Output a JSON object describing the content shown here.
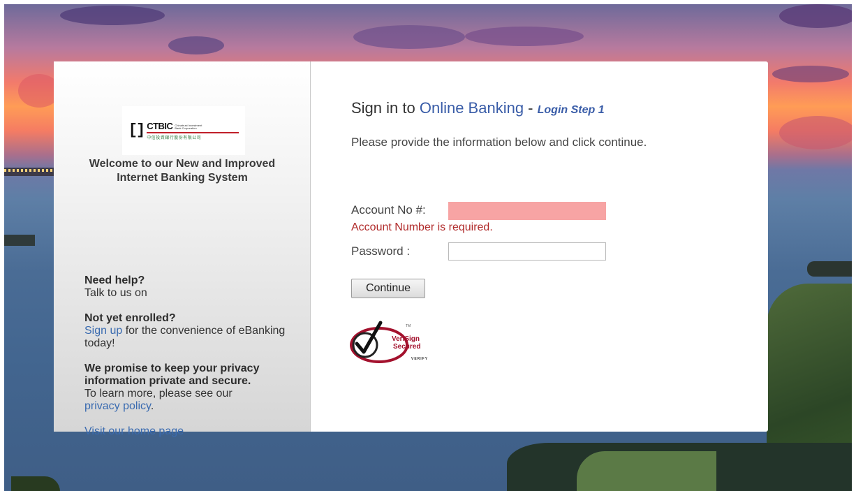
{
  "brand": {
    "logo_name": "CTBIC",
    "logo_english": "Chinatrust Investment Bank Corporation",
    "logo_chinese": "中信投資銀行股份有限公司"
  },
  "left_panel": {
    "welcome": "Welcome to our New and Improved Internet Banking System",
    "help_heading": "Need help?",
    "help_text": "Talk to us on",
    "enroll_heading": "Not yet enrolled?",
    "signup_link": "Sign up",
    "signup_text": " for the convenience of eBanking today!",
    "privacy_heading": "We promise to keep your privacy information private and secure.",
    "privacy_text": "To learn more, please see our",
    "privacy_link": "privacy policy",
    "privacy_tail": ".",
    "home_link": "Visit our home page"
  },
  "login": {
    "title_prefix": "Sign in to ",
    "title_highlight": "Online Banking",
    "title_sep": " - ",
    "step": "Login Step 1",
    "description": "Please provide the information below and click continue.",
    "account_label": "Account No #:",
    "account_value": "",
    "account_error": "Account Number is required.",
    "password_label": "Password :",
    "password_value": "",
    "continue_label": "Continue"
  },
  "seal": {
    "line1": "VeriSign",
    "line2": "Secured",
    "verify": "VERIFY",
    "tm": "TM"
  },
  "colors": {
    "link": "#3a6bb0",
    "title_accent": "#3a5da8",
    "error": "#b02a2a",
    "error_field": "#f7a4a4",
    "seal_red": "#a3112d"
  }
}
